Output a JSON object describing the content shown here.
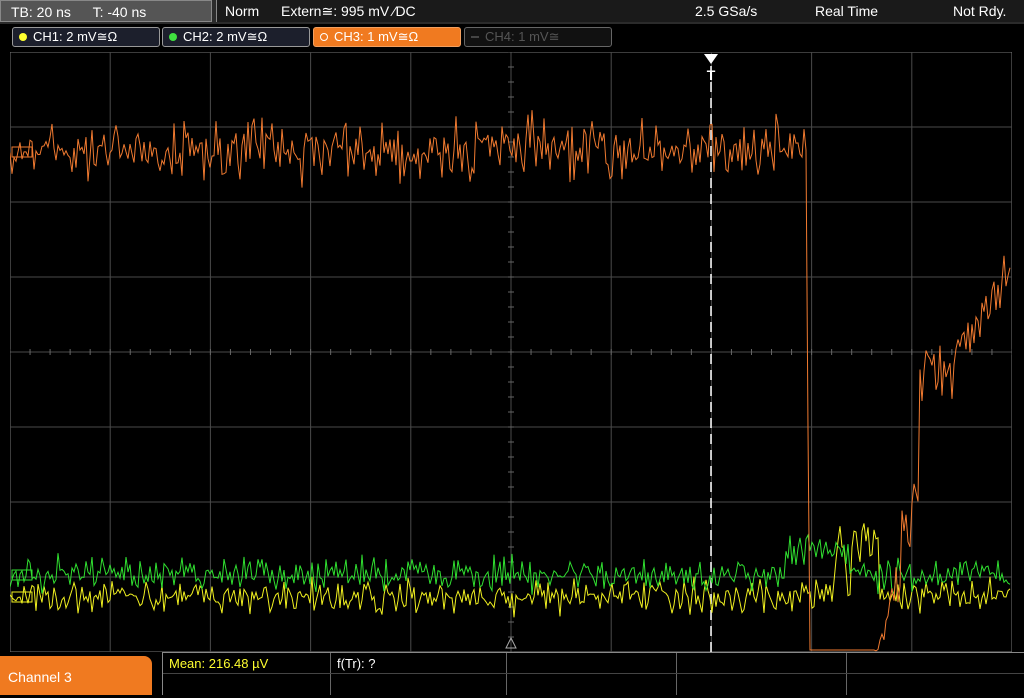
{
  "status": {
    "timebase": "TB: 20 ns",
    "time_offset": "T: -40 ns",
    "trigger_mode": "Norm",
    "trigger_source": "Extern≅: 995 mV ⁄DC",
    "sample_rate": "2.5 GSa/s",
    "acq_mode": "Real Time",
    "acq_state": "Not Rdy."
  },
  "channels": [
    {
      "label": "CH1: 2 mV≅Ω",
      "color": "#ffff30",
      "state": "on"
    },
    {
      "label": "CH2: 2 mV≅Ω",
      "color": "#40e040",
      "state": "on"
    },
    {
      "label": "CH3: 1 mV≅Ω",
      "color": "#ff8a3c",
      "state": "active"
    },
    {
      "label": "CH4: 1 mV≅",
      "color": "#555555",
      "state": "off"
    }
  ],
  "trigger_marker": "T",
  "bottom": {
    "channel_label": "Channel 3",
    "mean_label": "Mean: 216.48 µV",
    "ftr_label": "f(Tr): ?"
  },
  "colors": {
    "ch1": "#f0f020",
    "ch2": "#30e030",
    "ch3": "#f07a30",
    "grid": "#5a5a5a"
  }
}
